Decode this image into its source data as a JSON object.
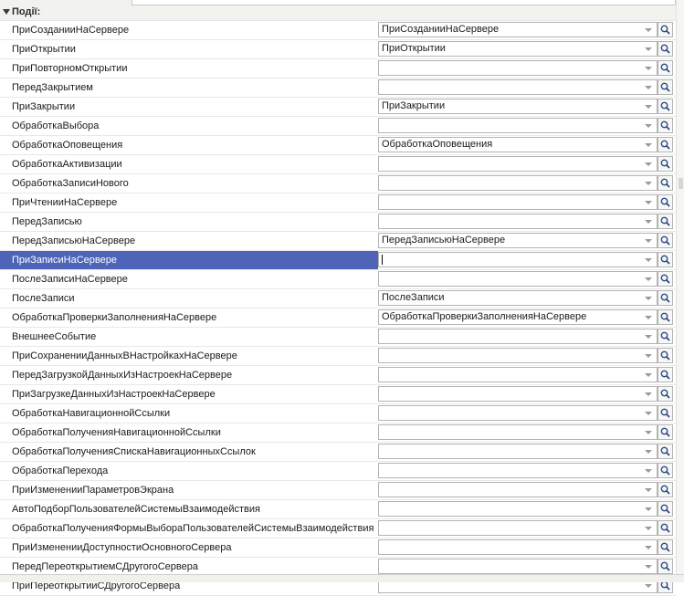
{
  "section": {
    "title": "Події:"
  },
  "rows": [
    {
      "name": "ПриСозданииНаСервере",
      "value": "ПриСозданииНаСервере"
    },
    {
      "name": "ПриОткрытии",
      "value": "ПриОткрытии"
    },
    {
      "name": "ПриПовторномОткрытии",
      "value": ""
    },
    {
      "name": "ПередЗакрытием",
      "value": ""
    },
    {
      "name": "ПриЗакрытии",
      "value": "ПриЗакрытии"
    },
    {
      "name": "ОбработкаВыбора",
      "value": ""
    },
    {
      "name": "ОбработкаОповещения",
      "value": "ОбработкаОповещения"
    },
    {
      "name": "ОбработкаАктивизации",
      "value": ""
    },
    {
      "name": "ОбработкаЗаписиНового",
      "value": ""
    },
    {
      "name": "ПриЧтенииНаСервере",
      "value": ""
    },
    {
      "name": "ПередЗаписью",
      "value": ""
    },
    {
      "name": "ПередЗаписьюНаСервере",
      "value": "ПередЗаписьюНаСервере"
    },
    {
      "name": "ПриЗаписиНаСервере",
      "value": "",
      "selected": true
    },
    {
      "name": "ПослеЗаписиНаСервере",
      "value": ""
    },
    {
      "name": "ПослеЗаписи",
      "value": "ПослеЗаписи"
    },
    {
      "name": "ОбработкаПроверкиЗаполненияНаСервере",
      "value": "ОбработкаПроверкиЗаполненияНаСервере"
    },
    {
      "name": "ВнешнееСобытие",
      "value": ""
    },
    {
      "name": "ПриСохраненииДанныхВНастройкахНаСервере",
      "value": ""
    },
    {
      "name": "ПередЗагрузкойДанныхИзНастроекНаСервере",
      "value": ""
    },
    {
      "name": "ПриЗагрузкеДанныхИзНастроекНаСервере",
      "value": ""
    },
    {
      "name": "ОбработкаНавигационнойСсылки",
      "value": ""
    },
    {
      "name": "ОбработкаПолученияНавигационнойСсылки",
      "value": ""
    },
    {
      "name": "ОбработкаПолученияСпискаНавигационныхСсылок",
      "value": ""
    },
    {
      "name": "ОбработкаПерехода",
      "value": ""
    },
    {
      "name": "ПриИзмененииПараметровЭкрана",
      "value": ""
    },
    {
      "name": "АвтоПодборПользователейСистемыВзаимодействия",
      "value": ""
    },
    {
      "name": "ОбработкаПолученияФормыВыбораПользователейСистемыВзаимодействия",
      "value": ""
    },
    {
      "name": "ПриИзмененииДоступностиОсновногоСервера",
      "value": ""
    },
    {
      "name": "ПередПереоткрытиемСДругогоСервера",
      "value": ""
    },
    {
      "name": "ПриПереоткрытииСДругогоСервера",
      "value": ""
    }
  ],
  "icons": {
    "dropdown": "chevron-down-icon",
    "search": "search-icon",
    "collapse": "triangle-down-icon"
  },
  "colors": {
    "selection": "#4d64b8",
    "selection_text": "#ffffff"
  }
}
